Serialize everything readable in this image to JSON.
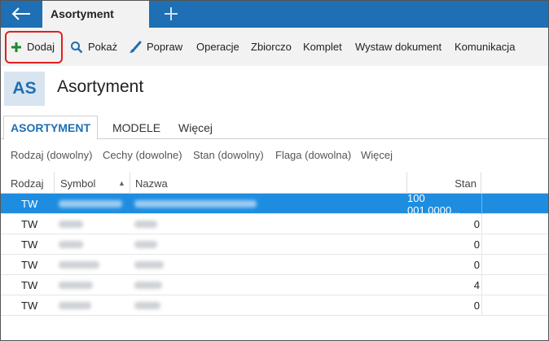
{
  "window": {
    "tab_title": "Asortyment"
  },
  "toolbar": {
    "items": [
      {
        "label": "Dodaj",
        "icon": "plus-icon"
      },
      {
        "label": "Pokaż",
        "icon": "search-icon"
      },
      {
        "label": "Popraw",
        "icon": "brush-icon"
      },
      {
        "label": "Operacje"
      },
      {
        "label": "Zbiorczo"
      },
      {
        "label": "Komplet"
      },
      {
        "label": "Wystaw dokument"
      },
      {
        "label": "Komunikacja"
      }
    ]
  },
  "header": {
    "badge": "AS",
    "title": "Asortyment"
  },
  "subtabs": [
    {
      "label": "ASORTYMENT",
      "active": true
    },
    {
      "label": "MODELE"
    },
    {
      "label": "Więcej"
    }
  ],
  "filters": [
    "Rodzaj (dowolny)",
    "Cechy (dowolne)",
    "Stan (dowolny)",
    "Flaga (dowolna)",
    "Więcej"
  ],
  "grid": {
    "columns": [
      "Rodzaj",
      "Symbol",
      "Nazwa",
      "Stan"
    ],
    "sort_indicator": "▲",
    "rows": [
      {
        "rodzaj": "TW",
        "stan": "100 001,0000...",
        "selected": true
      },
      {
        "rodzaj": "TW",
        "stan": "0"
      },
      {
        "rodzaj": "TW",
        "stan": "0"
      },
      {
        "rodzaj": "TW",
        "stan": "0"
      },
      {
        "rodzaj": "TW",
        "stan": "4"
      },
      {
        "rodzaj": "TW",
        "stan": "0"
      }
    ]
  },
  "colors": {
    "accent": "#1e6fb3",
    "selection": "#1e8de0",
    "highlight": "#e02020",
    "add_icon": "#1d8a2b"
  }
}
